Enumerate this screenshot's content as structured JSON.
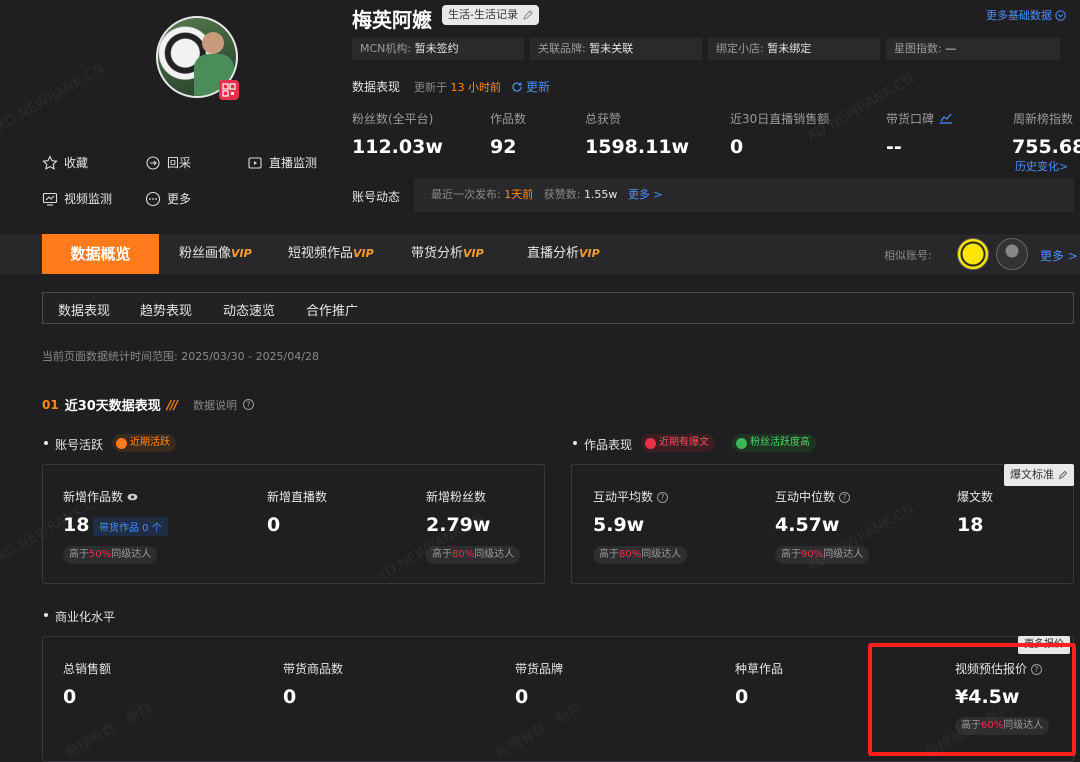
{
  "profile": {
    "name": "梅英阿嬷",
    "category": "生活-生活记录",
    "more_base_data": "更多基础数据",
    "mcn_label": "MCN机构:",
    "mcn_value": "暂未签约",
    "brand_label": "关联品牌:",
    "brand_value": "暂未关联",
    "shop_label": "绑定小店:",
    "shop_value": "暂未绑定",
    "star_label": "星图指数:",
    "star_value": "—"
  },
  "actions": [
    {
      "label": "收藏",
      "icon": "star-icon"
    },
    {
      "label": "回采",
      "icon": "refresh-collect-icon"
    },
    {
      "label": "直播监测",
      "icon": "live-monitor-icon"
    },
    {
      "label": "视频监测",
      "icon": "video-monitor-icon"
    },
    {
      "label": "更多",
      "icon": "more-icon"
    }
  ],
  "performance": {
    "title": "数据表现",
    "updated_prefix": "更新于",
    "updated_value": "13 小时前",
    "refresh_label": "更新"
  },
  "metrics": [
    {
      "label": "粉丝数(全平台)",
      "value": "112.03w"
    },
    {
      "label": "作品数",
      "value": "92"
    },
    {
      "label": "总获赞",
      "value": "1598.11w"
    },
    {
      "label": "近30日直播销售额",
      "value": "0"
    },
    {
      "label": "带货口碑",
      "value": "--"
    },
    {
      "label": "周新榜指数",
      "value": "755.68",
      "link": "历史变化>"
    }
  ],
  "dynamic": {
    "title": "账号动态",
    "last_publish_label": "最近一次发布:",
    "last_publish_value": "1天前",
    "likes_label": "获赞数:",
    "likes_value": "1.55w",
    "more": "更多 >"
  },
  "tabs": {
    "active": "数据概览",
    "items": [
      {
        "label": "粉丝画像",
        "vip": "VIP"
      },
      {
        "label": "短视频作品",
        "vip": "VIP"
      },
      {
        "label": "带货分析",
        "vip": "VIP"
      },
      {
        "label": "直播分析",
        "vip": "VIP"
      }
    ],
    "similar_label": "相似账号:",
    "similar_more": "更多 >"
  },
  "subtabs": [
    "数据表现",
    "趋势表现",
    "动态速览",
    "合作推广"
  ],
  "period": "当前页面数据统计时间范围: 2025/03/30 - 2025/04/28",
  "section30": {
    "index": "01",
    "title": "近30天数据表现",
    "explain": "数据说明"
  },
  "activity": {
    "title": "账号活跃",
    "badge": "近期活跃",
    "items": [
      {
        "label": "新增作品数",
        "value": "18",
        "extra": "带货作品 0 个",
        "compare_prefix": "高于",
        "compare_pct": "50%",
        "compare_suffix": "同级达人"
      },
      {
        "label": "新增直播数",
        "value": "0"
      },
      {
        "label": "新增粉丝数",
        "value": "2.79w",
        "compare_prefix": "高于",
        "compare_pct": "80%",
        "compare_suffix": "同级达人"
      }
    ]
  },
  "works": {
    "title": "作品表现",
    "badge1": "近期有爆文",
    "badge2": "粉丝活跃度高",
    "standard": "爆文标准",
    "items": [
      {
        "label": "互动平均数",
        "value": "5.9w",
        "compare_prefix": "高于",
        "compare_pct": "80%",
        "compare_suffix": "同级达人"
      },
      {
        "label": "互动中位数",
        "value": "4.57w",
        "compare_prefix": "高于",
        "compare_pct": "90%",
        "compare_suffix": "同级达人"
      },
      {
        "label": "爆文数",
        "value": "18"
      }
    ]
  },
  "commerce": {
    "title": "商业化水平",
    "more_quote": "更多报价",
    "items": [
      {
        "label": "总销售额",
        "value": "0"
      },
      {
        "label": "带货商品数",
        "value": "0"
      },
      {
        "label": "带货品牌",
        "value": "0"
      },
      {
        "label": "种草作品",
        "value": "0"
      },
      {
        "label": "视频预估报价",
        "value": "¥4.5w",
        "compare_prefix": "高于",
        "compare_pct": "60%",
        "compare_suffix": "同级达人"
      }
    ]
  },
  "watermarks": [
    "XD.NEWRANK.CN",
    "新榜有数 · 新抖"
  ],
  "colors": {
    "accent": "#ff7a1a",
    "link": "#4b8fff",
    "highlight": "#ff1f1f",
    "background": "#1f1f21"
  }
}
